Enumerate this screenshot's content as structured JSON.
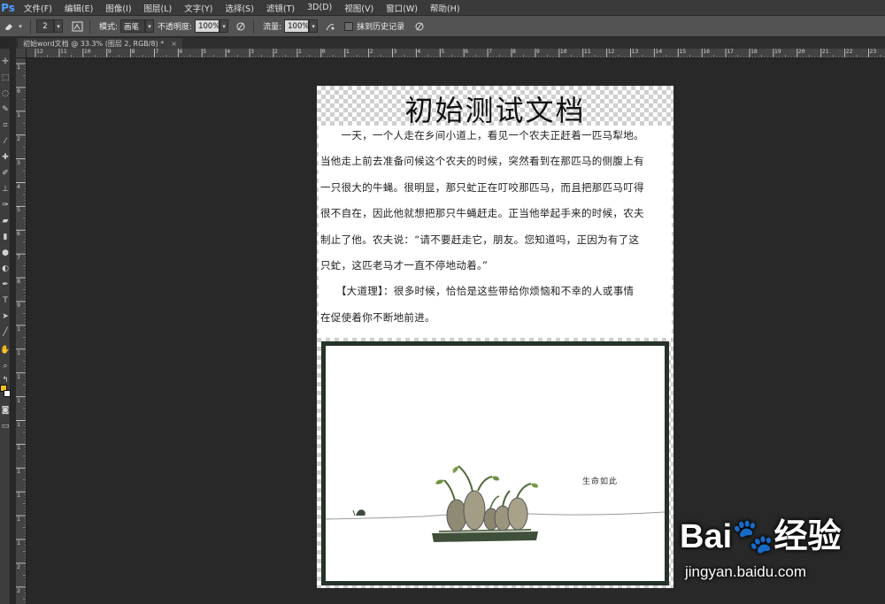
{
  "app": {
    "logo": "Ps"
  },
  "menu": [
    "文件(F)",
    "编辑(E)",
    "图像(I)",
    "图层(L)",
    "文字(Y)",
    "选择(S)",
    "滤镜(T)",
    "3D(D)",
    "视图(V)",
    "窗口(W)",
    "帮助(H)"
  ],
  "options": {
    "brush_size": "2",
    "mode_label": "模式:",
    "mode_value": "画笔",
    "opacity_label": "不透明度:",
    "opacity_value": "100%",
    "flow_label": "流量:",
    "flow_value": "100%",
    "history_label": "抹到历史记录"
  },
  "tab": {
    "title": "初始word文档 @ 33.3% (图层 2, RGB/8) *",
    "close": "×"
  },
  "ruler_top": [
    "12",
    "11",
    "10",
    "9",
    "8",
    "7",
    "6",
    "5",
    "4",
    "3",
    "2",
    "1",
    "0",
    "1",
    "2",
    "3",
    "4",
    "5",
    "6",
    "7",
    "8",
    "9",
    "10",
    "11",
    "12",
    "13",
    "14",
    "15",
    "16",
    "17",
    "18",
    "19",
    "20",
    "21",
    "22",
    "23"
  ],
  "ruler_left": [
    "1",
    "0",
    "1",
    "2",
    "3",
    "4",
    "5",
    "6",
    "7",
    "8",
    "9",
    "1",
    "1",
    "1",
    "1",
    "1",
    "1",
    "1",
    "1",
    "1",
    "1",
    "2",
    "2",
    "2"
  ],
  "document": {
    "title": "初始测试文档",
    "lines": [
      "　　一天，一个人走在乡间小道上，看见一个农夫正赶着一匹马犁地。",
      "当他走上前去准备问候这个农夫的时候，突然看到在那匹马的侧腹上有",
      "一只很大的牛蝇。很明显，那只虻正在叮咬那匹马，而且把那匹马叮得",
      "很不自在，因此他就想把那只牛蝇赶走。正当他举起手来的时候，农夫",
      "制止了他。农夫说：“请不要赶走它，朋友。您知道吗，正因为有了这",
      "只虻，这匹老马才一直不停地动着。”",
      "　　【大道理】：很多时候，恰恰是这些带给你烦恼和不幸的人或事情",
      "在促使着你不断地前进。"
    ],
    "photo_caption": "生命如此"
  },
  "watermark": {
    "logo": "Bai🐾经验",
    "url": "jingyan.baidu.com"
  },
  "colors": {
    "foreground": "#f2c224",
    "background": "#ffffff",
    "photo_frame": "#253328"
  }
}
